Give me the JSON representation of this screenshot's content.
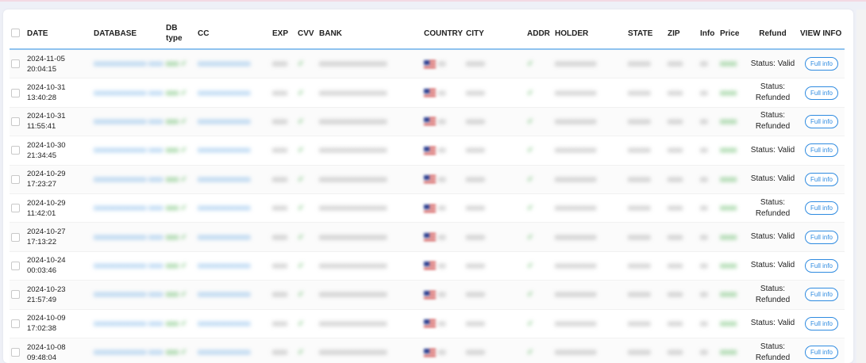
{
  "columns": {
    "date": "DATE",
    "database": "DATABASE",
    "db_type": "DB type",
    "cc": "CC",
    "exp": "EXP",
    "cvv": "CVV",
    "bank": "BANK",
    "country": "COUNTRY",
    "city": "CITY",
    "addr": "ADDR",
    "holder": "HOLDER",
    "state": "STATE",
    "zip": "ZIP",
    "info": "Info",
    "price": "Price",
    "refund": "Refund",
    "view_info": "VIEW INFO"
  },
  "rows": [
    {
      "date": "2024-11-05",
      "time": "20:04:15",
      "refund": "Status: Valid",
      "btn": "Full info"
    },
    {
      "date": "2024-10-31",
      "time": "13:40:28",
      "refund": "Status: Refunded",
      "btn": "Full info"
    },
    {
      "date": "2024-10-31",
      "time": "11:55:41",
      "refund": "Status: Refunded",
      "btn": "Full info"
    },
    {
      "date": "2024-10-30",
      "time": "21:34:45",
      "refund": "Status: Valid",
      "btn": "Full info"
    },
    {
      "date": "2024-10-29",
      "time": "17:23:27",
      "refund": "Status: Valid",
      "btn": "Full info"
    },
    {
      "date": "2024-10-29",
      "time": "11:42:01",
      "refund": "Status: Refunded",
      "btn": "Full info"
    },
    {
      "date": "2024-10-27",
      "time": "17:13:22",
      "refund": "Status: Valid",
      "btn": "Full info"
    },
    {
      "date": "2024-10-24",
      "time": "00:03:46",
      "refund": "Status: Valid",
      "btn": "Full info"
    },
    {
      "date": "2024-10-23",
      "time": "21:57:49",
      "refund": "Status: Refunded",
      "btn": "Full info"
    },
    {
      "date": "2024-10-09",
      "time": "17:02:38",
      "refund": "Status: Valid",
      "btn": "Full info"
    },
    {
      "date": "2024-10-08",
      "time": "09:48:04",
      "refund": "Status: Refunded",
      "btn": "Full info"
    }
  ]
}
